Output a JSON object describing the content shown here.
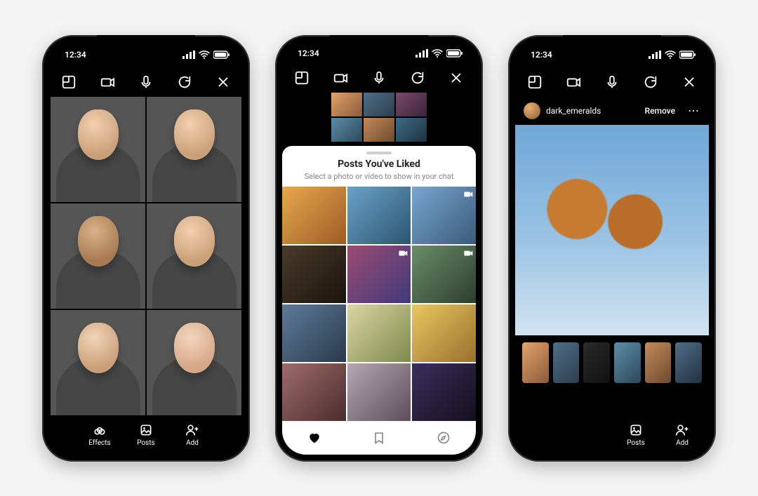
{
  "status": {
    "time": "12:34"
  },
  "toolbar": {
    "layout_icon": "layout-icon",
    "camera_icon": "camera-flip-icon",
    "mic_icon": "microphone-icon",
    "refresh_icon": "refresh-icon",
    "close_icon": "close-icon"
  },
  "phone1": {
    "bottom": {
      "effects": "Effects",
      "posts": "Posts",
      "add": "Add"
    }
  },
  "phone2": {
    "sheet_title": "Posts You've Liked",
    "sheet_subtitle": "Select a photo or video to show in your chat",
    "tabs": {
      "liked": "liked",
      "saved": "saved",
      "explore": "explore"
    }
  },
  "phone3": {
    "username": "dark_emeralds",
    "remove_label": "Remove",
    "bottom": {
      "posts": "Posts",
      "add": "Add"
    }
  }
}
